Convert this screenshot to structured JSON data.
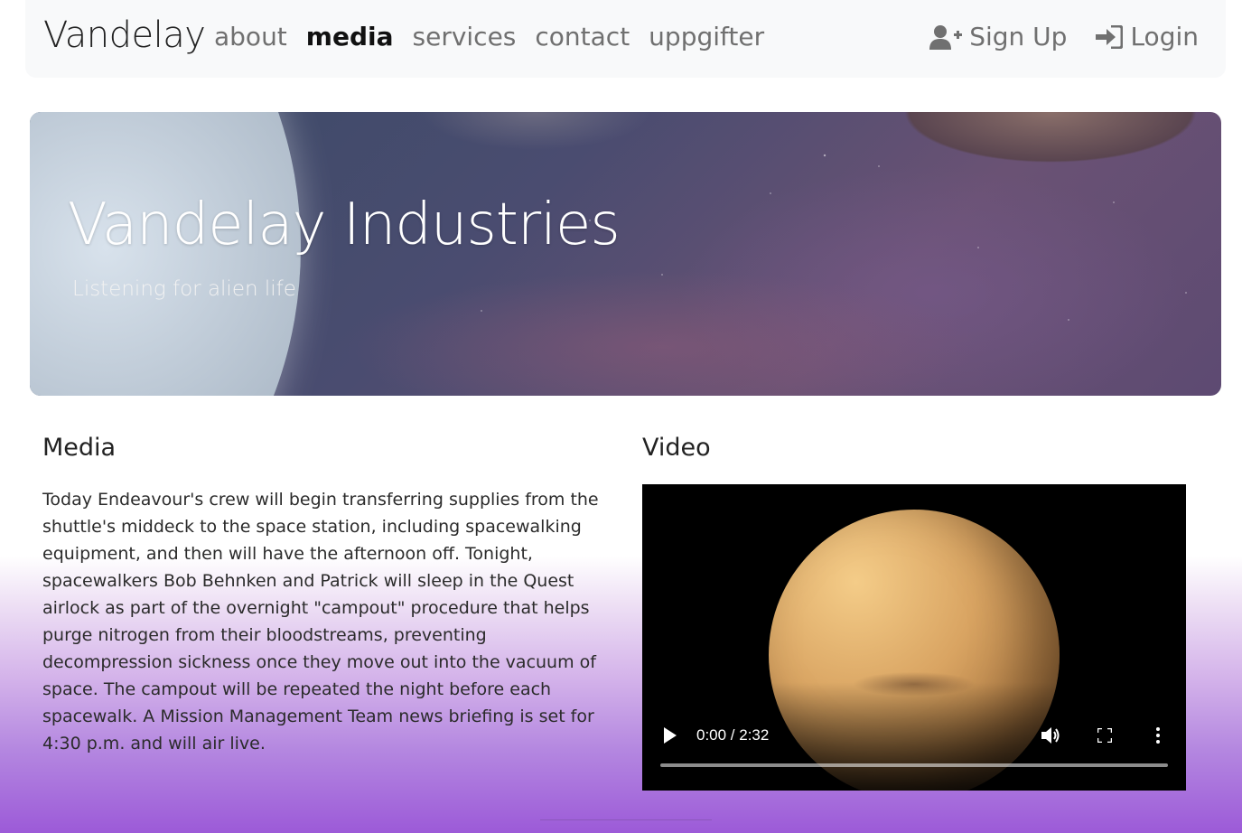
{
  "navbar": {
    "brand": "Vandelay",
    "links": [
      {
        "label": "about",
        "active": false
      },
      {
        "label": "media",
        "active": true
      },
      {
        "label": "services",
        "active": false
      },
      {
        "label": "contact",
        "active": false
      },
      {
        "label": "uppgifter",
        "active": false
      }
    ],
    "signup_label": "Sign Up",
    "login_label": "Login"
  },
  "hero": {
    "title": "Vandelay Industries",
    "subtitle": "Listening for alien life"
  },
  "media": {
    "heading": "Media",
    "text": "Today Endeavour's crew will begin transferring supplies from the shuttle's middeck to the space station, including spacewalking equipment, and then will have the afternoon off. Tonight, spacewalkers Bob Behnken and Patrick will sleep in the Quest airlock as part of the overnight \"campout\" procedure that helps purge nitrogen from their bloodstreams, preventing decompression sickness once they move out into the vacuum of space. The campout will be repeated the night before each spacewalk. A Mission Management Team news briefing is set for 4:30 p.m. and will air live."
  },
  "video": {
    "heading": "Video",
    "time_display": "0:00 / 2:32",
    "progress": 0,
    "icons": {
      "play": "play-icon",
      "volume": "volume-icon",
      "fullscreen": "fullscreen-icon",
      "more": "more-options-icon"
    }
  },
  "colors": {
    "navbar_bg": "#f8f9fa",
    "active_link": "#111111",
    "inactive_link": "#707070",
    "gradient_bottom": "#9c5ad8"
  }
}
